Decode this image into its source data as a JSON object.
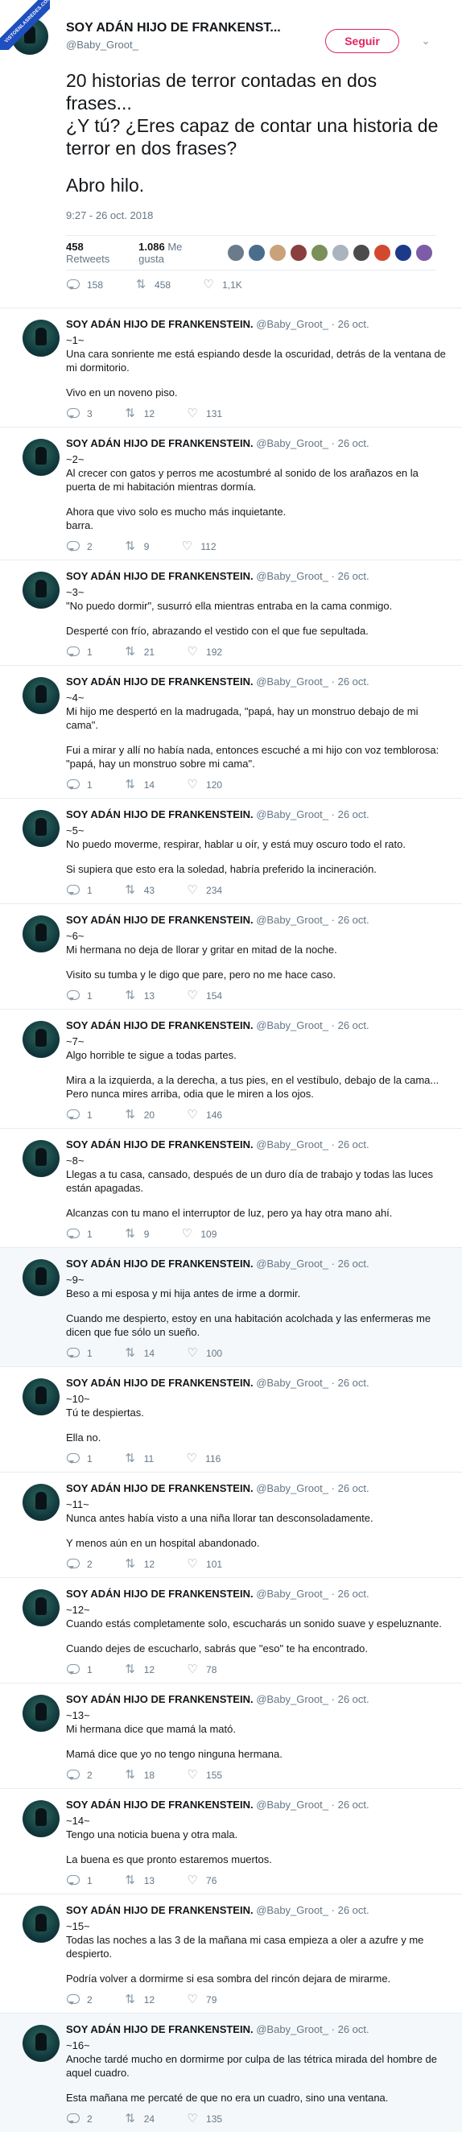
{
  "watermark": "VISTOENLASREDES.COM",
  "header": {
    "name": "SOY ADÁN HIJO DE FRANKENST...",
    "handle": "@Baby_Groot_",
    "follow_label": "Seguir",
    "caret_icon": "chevron-down-icon"
  },
  "tweet": {
    "text1": "20 historias de terror contadas en dos frases...\n ¿Y tú? ¿Eres capaz de contar una historia de terror en dos frases?",
    "text2": "Abro hilo.",
    "timestamp": "9:27 - 26 oct. 2018",
    "retweets_count": "458",
    "retweets_label": "Retweets",
    "likes_count": "1.086",
    "likes_label": "Me gusta",
    "liker_colors": [
      "#6b7b8c",
      "#4a6d8c",
      "#c9a27a",
      "#8a3f3f",
      "#7b8f5a",
      "#aab4be",
      "#4b4b4b",
      "#d14a2f",
      "#1d3a8a",
      "#7d5ba6"
    ],
    "actions": {
      "replies": "158",
      "retweets": "458",
      "likes": "1,1K"
    }
  },
  "reply_author": {
    "name": "SOY ADÁN HIJO DE FRANKENSTEIN.",
    "handle": "@Baby_Groot_",
    "date": "26 oct."
  },
  "replies": [
    {
      "num": "~1~",
      "paras": [
        "Una cara sonriente me está espiando desde la oscuridad, detrás de la ventana de mi dormitorio.",
        "Vivo en un noveno piso."
      ],
      "r": "3",
      "rt": "12",
      "l": "131"
    },
    {
      "num": "~2~",
      "paras": [
        "Al crecer con gatos y perros me acostumbré al sonido de los arañazos en la puerta de mi habitación mientras dormía.",
        "Ahora que vivo solo es mucho más inquietante.\nbarra."
      ],
      "r": "2",
      "rt": "9",
      "l": "112"
    },
    {
      "num": "~3~",
      "paras": [
        "\"No puedo dormir\", susurró ella mientras entraba en la cama conmigo.",
        "Desperté con frío, abrazando el vestido con el que fue sepultada."
      ],
      "r": "1",
      "rt": "21",
      "l": "192"
    },
    {
      "num": "~4~",
      "paras": [
        "Mi hijo me despertó en la madrugada, \"papá, hay un monstruo debajo de mi cama\".",
        "Fui a mirar y allí no había nada, entonces escuché a mi hijo con voz temblorosa: \"papá, hay un monstruo sobre mi cama\"."
      ],
      "r": "1",
      "rt": "14",
      "l": "120"
    },
    {
      "num": "~5~",
      "paras": [
        "No puedo moverme, respirar, hablar u oír, y está muy oscuro todo el rato.",
        "Si supiera que esto era la soledad, habría preferido la incineración."
      ],
      "r": "1",
      "rt": "43",
      "l": "234"
    },
    {
      "num": "~6~",
      "paras": [
        "Mi hermana no deja de llorar y gritar en mitad de la noche.",
        "Visito su tumba y le digo que pare, pero no me hace caso."
      ],
      "r": "1",
      "rt": "13",
      "l": "154"
    },
    {
      "num": "~7~",
      "paras": [
        "Algo horrible te sigue a todas partes.",
        "Mira a la izquierda, a la  derecha, a tus pies, en el vestíbulo, debajo de la cama... Pero nunca mires arriba, odia que le miren a los ojos."
      ],
      "r": "1",
      "rt": "20",
      "l": "146"
    },
    {
      "num": "~8~",
      "paras": [
        "Llegas a tu casa, cansado, después de un duro día de trabajo y todas las luces están apagadas.",
        "Alcanzas con tu mano el interruptor de luz, pero ya hay otra mano ahí."
      ],
      "r": "1",
      "rt": "9",
      "l": "109"
    },
    {
      "num": "~9~",
      "paras": [
        "Beso a mi esposa y mi hija antes de irme a dormir.",
        "Cuando me despierto, estoy en una habitación acolchada y las enfermeras me dicen que fue sólo un sueño."
      ],
      "r": "1",
      "rt": "14",
      "l": "100",
      "hl": true
    },
    {
      "num": "~10~",
      "paras": [
        "Tú te despiertas.",
        "Ella no."
      ],
      "r": "1",
      "rt": "11",
      "l": "116"
    },
    {
      "num": "~11~",
      "paras": [
        "Nunca antes había visto a una niña llorar tan desconsoladamente.",
        "Y menos aún en un hospital abandonado."
      ],
      "r": "2",
      "rt": "12",
      "l": "101"
    },
    {
      "num": "~12~",
      "paras": [
        "Cuando estás completamente solo, escucharás un sonido suave y espeluznante.",
        "Cuando dejes de escucharlo, sabrás que \"eso\" te ha encontrado."
      ],
      "r": "1",
      "rt": "12",
      "l": "78"
    },
    {
      "num": "~13~",
      "paras": [
        "Mi hermana dice que mamá la mató.",
        "Mamá dice que yo no tengo ninguna hermana."
      ],
      "r": "2",
      "rt": "18",
      "l": "155"
    },
    {
      "num": "~14~",
      "paras": [
        "Tengo una noticia buena y otra mala.",
        "La buena es que pronto estaremos muertos."
      ],
      "r": "1",
      "rt": "13",
      "l": "76"
    },
    {
      "num": "~15~",
      "paras": [
        "Todas las noches a las 3 de la mañana mi casa empieza a oler a azufre y me despierto.",
        "Podría volver a dormirme si esa sombra del rincón dejara de mirarme."
      ],
      "r": "2",
      "rt": "12",
      "l": "79"
    },
    {
      "num": "~16~",
      "paras": [
        "Anoche tardé mucho en dormirme por culpa de las tétrica mirada del hombre de aquel cuadro.",
        "Esta mañana me percaté de que no era un cuadro, sino una ventana."
      ],
      "r": "2",
      "rt": "24",
      "l": "135",
      "hl": true
    }
  ]
}
